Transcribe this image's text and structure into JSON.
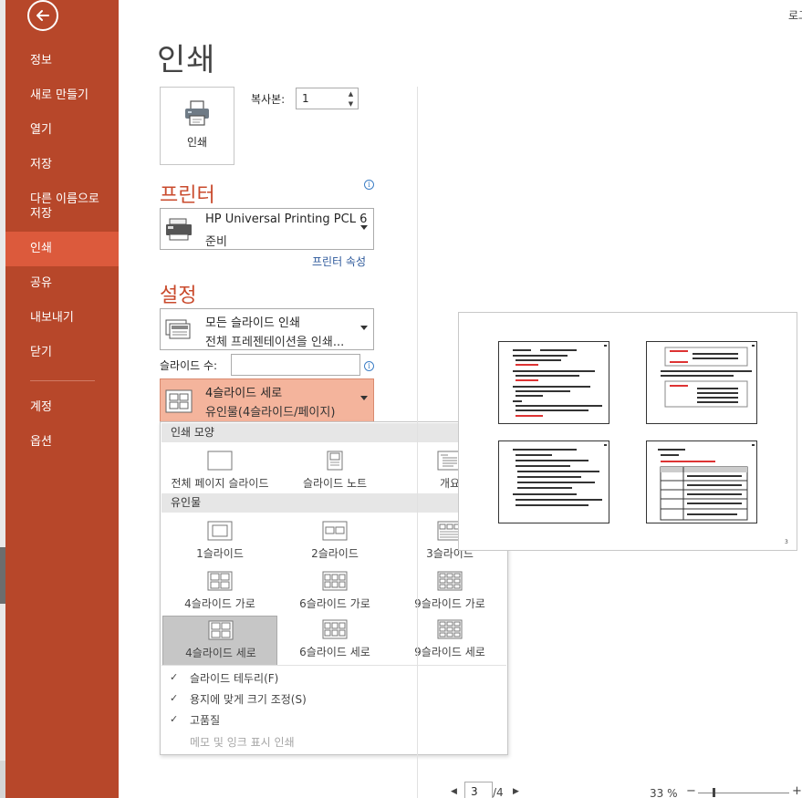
{
  "window": {
    "top_right_text": "로그"
  },
  "sidebar": {
    "back_label": "←",
    "items": [
      {
        "label": "정보"
      },
      {
        "label": "새로 만들기"
      },
      {
        "label": "열기"
      },
      {
        "label": "저장"
      },
      {
        "label": "다른 이름으로\n저장"
      },
      {
        "label": "인쇄",
        "active": true
      },
      {
        "label": "공유"
      },
      {
        "label": "내보내기"
      },
      {
        "label": "닫기"
      },
      {
        "label": "계정"
      },
      {
        "label": "옵션"
      }
    ]
  },
  "main": {
    "title": "인쇄",
    "print_button": {
      "label": "인쇄",
      "icon": "printer-icon"
    },
    "copies": {
      "label": "복사본:",
      "value": "1"
    },
    "printer": {
      "heading": "프린터",
      "name": "HP Universal Printing PCL 6",
      "status": "준비",
      "properties_link": "프린터 속성",
      "info_icon": "i"
    },
    "settings": {
      "heading": "설정",
      "range": {
        "main": "모든 슬라이드 인쇄",
        "sub": "전체 프레젠테이션을 인쇄..."
      },
      "slides_label": "슬라이드 수:",
      "slides_value": "",
      "layout": {
        "main": "4슬라이드 세로",
        "sub": "유인물(4슬라이드/페이지)"
      }
    }
  },
  "flyout": {
    "print_layout_header": "인쇄 모양",
    "print_layout": [
      {
        "label": "전체 페이지 슬라이드",
        "icon": "full-page-slide-icon"
      },
      {
        "label": "슬라이드 노트",
        "icon": "notes-page-icon"
      },
      {
        "label": "개요",
        "icon": "outline-icon"
      }
    ],
    "handouts_header": "유인물",
    "handouts": [
      {
        "label": "1슬라이드",
        "icon": "handout-1-icon"
      },
      {
        "label": "2슬라이드",
        "icon": "handout-2-icon"
      },
      {
        "label": "3슬라이드",
        "icon": "handout-3-icon"
      },
      {
        "label": "4슬라이드 가로",
        "icon": "handout-4h-icon"
      },
      {
        "label": "6슬라이드 가로",
        "icon": "handout-6h-icon"
      },
      {
        "label": "9슬라이드 가로",
        "icon": "handout-9h-icon"
      },
      {
        "label": "4슬라이드 세로",
        "icon": "handout-4v-icon",
        "selected": true
      },
      {
        "label": "6슬라이드 세로",
        "icon": "handout-6v-icon"
      },
      {
        "label": "9슬라이드 세로",
        "icon": "handout-9v-icon"
      }
    ],
    "options": [
      {
        "label": "슬라이드 테두리(F)",
        "checked": true,
        "enabled": true
      },
      {
        "label": "용지에 맞게 크기 조정(S)",
        "checked": true,
        "enabled": true
      },
      {
        "label": "고품질",
        "checked": true,
        "enabled": true
      },
      {
        "label": "메모 및 잉크 표시 인쇄",
        "checked": false,
        "enabled": false
      }
    ]
  },
  "preview": {
    "page_number": "3"
  },
  "pager": {
    "current": "3",
    "total": "/4",
    "prev_icon": "◀",
    "next_icon": "▶"
  },
  "zoom": {
    "level_text": "33 %",
    "minus": "−",
    "plus": "+",
    "level": 0.33
  },
  "colors": {
    "sidebar_bg": "#b7472a",
    "sidebar_active": "#dc5a3c",
    "heading": "#c94a2c",
    "layout_dropdown_bg": "#f4b49c"
  }
}
